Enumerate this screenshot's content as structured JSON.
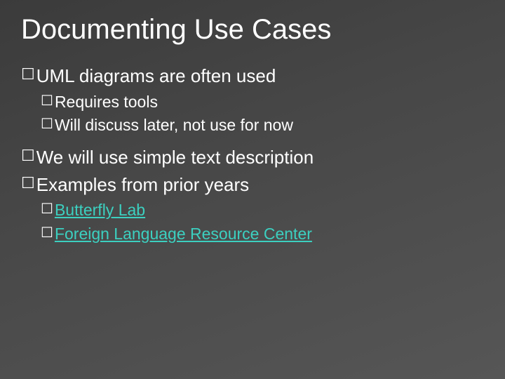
{
  "title": "Documenting Use Cases",
  "bullets": {
    "b1": "UML diagrams are often used",
    "b1a": "Requires tools",
    "b1b": "Will discuss later, not use for now",
    "b2": "We will use simple text description",
    "b3": "Examples from prior years",
    "b3a": "Butterfly Lab",
    "b3b": "Foreign Language Resource Center"
  },
  "glyphs": {
    "square": "☐"
  }
}
